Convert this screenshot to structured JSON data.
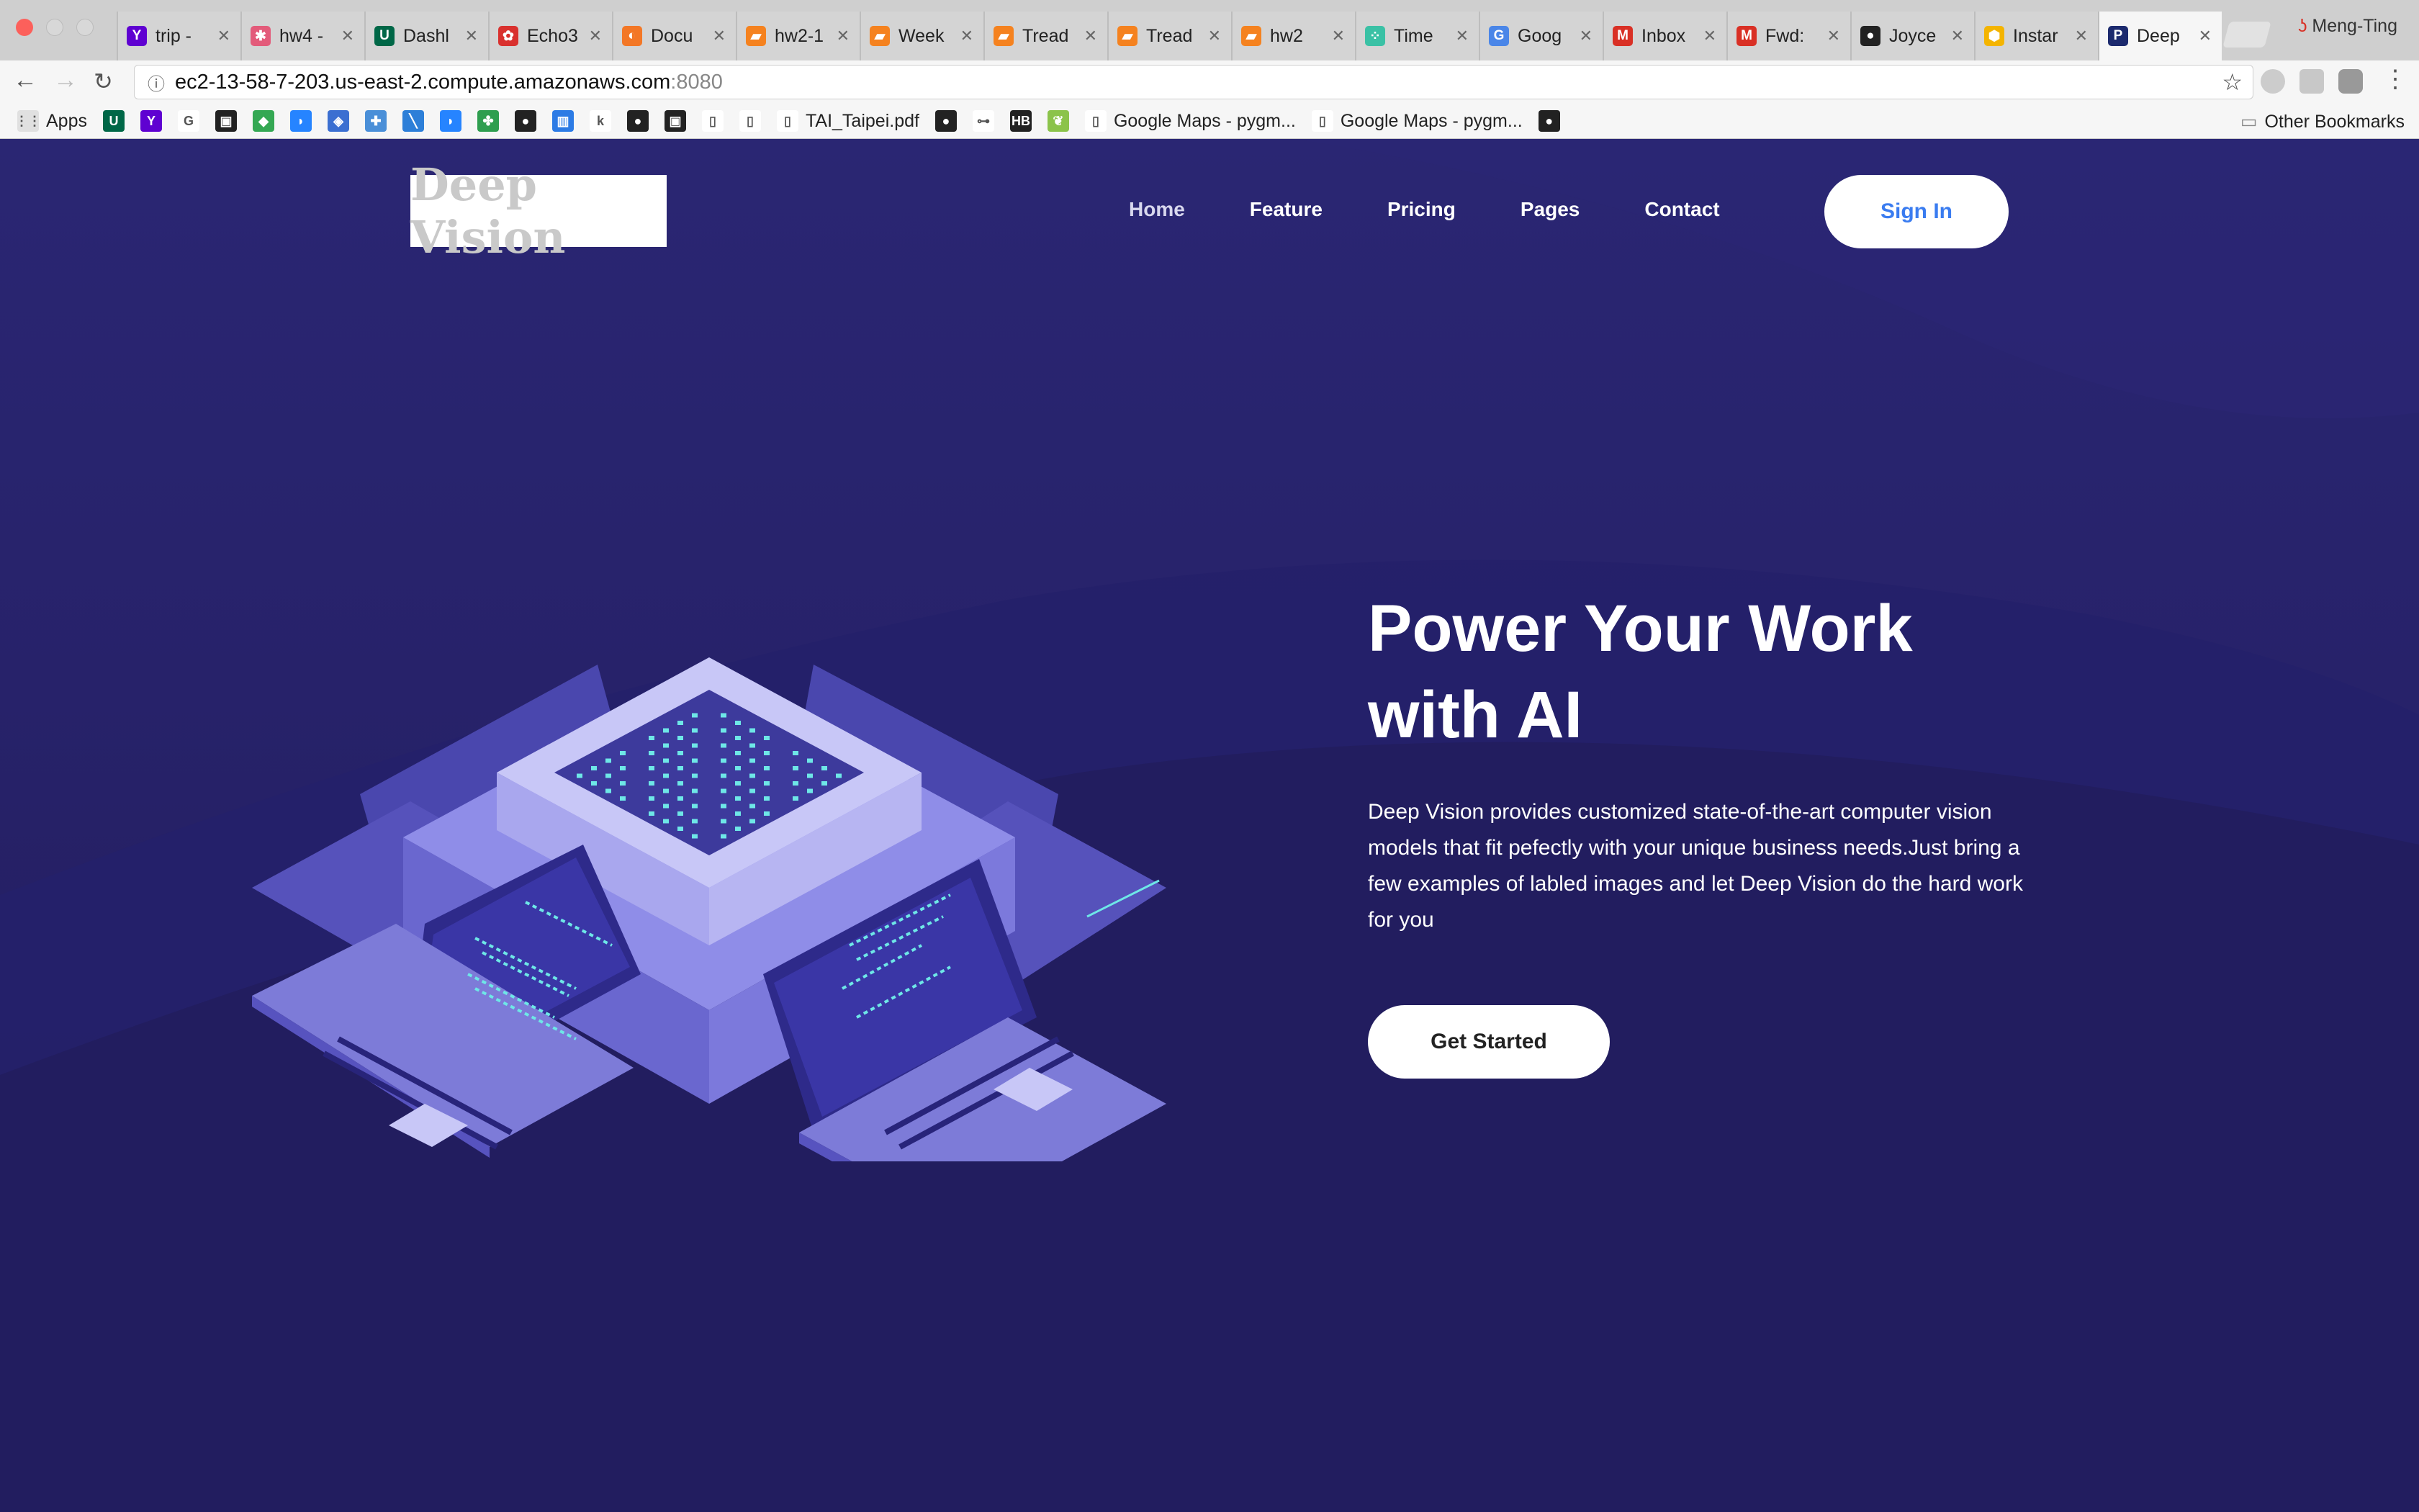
{
  "browser": {
    "tabs": [
      {
        "title": "trip -",
        "icon": "yahoo-icon",
        "color": "#5f01d1",
        "glyph": "Y",
        "active": false
      },
      {
        "title": "hw4 -",
        "icon": "asana-icon",
        "color": "#e35b7a",
        "glyph": "✱",
        "active": false
      },
      {
        "title": "Dashl",
        "icon": "usf-icon",
        "color": "#006747",
        "glyph": "U",
        "active": false
      },
      {
        "title": "Echo3",
        "icon": "echo-icon",
        "color": "#d9312e",
        "glyph": "✿",
        "active": false
      },
      {
        "title": "Docu",
        "icon": "jupyter-icon",
        "color": "#f37726",
        "glyph": "◐",
        "active": false
      },
      {
        "title": "hw2-1",
        "icon": "notebook-icon",
        "color": "#f5821f",
        "glyph": "▰",
        "active": false
      },
      {
        "title": "Week",
        "icon": "notebook-icon",
        "color": "#f5821f",
        "glyph": "▰",
        "active": false
      },
      {
        "title": "Tread",
        "icon": "notebook-icon",
        "color": "#f5821f",
        "glyph": "▰",
        "active": false
      },
      {
        "title": "Tread",
        "icon": "notebook-icon",
        "color": "#f5821f",
        "glyph": "▰",
        "active": false
      },
      {
        "title": "hw2",
        "icon": "notebook-icon",
        "color": "#f5821f",
        "glyph": "▰",
        "active": false
      },
      {
        "title": "Time",
        "icon": "timeline-icon",
        "color": "#3ac1a5",
        "glyph": "⁘",
        "active": false
      },
      {
        "title": "Goog",
        "icon": "google-translate-icon",
        "color": "#4a86e8",
        "glyph": "G",
        "active": false
      },
      {
        "title": "Inbox",
        "icon": "gmail-icon",
        "color": "#d93025",
        "glyph": "M",
        "active": false
      },
      {
        "title": "Fwd:",
        "icon": "gmail-icon",
        "color": "#d93025",
        "glyph": "M",
        "active": false
      },
      {
        "title": "Joyce",
        "icon": "github-icon",
        "color": "#222222",
        "glyph": "●",
        "active": false
      },
      {
        "title": "Instar",
        "icon": "instance-icon",
        "color": "#f4b400",
        "glyph": "⬢",
        "active": false
      },
      {
        "title": "Deep",
        "icon": "paypal-style-icon",
        "color": "#1c2a6e",
        "glyph": "P",
        "active": true
      }
    ],
    "profile_name": "Meng-Ting",
    "url_host": "ec2-13-58-7-203.us-east-2.compute.amazonaws.com",
    "url_port": ":8080",
    "bookmarks": [
      {
        "label": "Apps",
        "icon": "apps-grid-icon",
        "color": "#e0e0e0",
        "glyph": "⋮⋮"
      },
      {
        "label": "",
        "icon": "usf-icon",
        "color": "#006747",
        "glyph": "U"
      },
      {
        "label": "",
        "icon": "yahoo-icon",
        "color": "#5f01d1",
        "glyph": "Y"
      },
      {
        "label": "",
        "icon": "google-icon",
        "color": "#ffffff",
        "glyph": "G"
      },
      {
        "label": "",
        "icon": "bookmark-dark-icon",
        "color": "#222222",
        "glyph": "▣"
      },
      {
        "label": "",
        "icon": "maps-icon",
        "color": "#34a853",
        "glyph": "◆"
      },
      {
        "label": "",
        "icon": "bitbucket-icon",
        "color": "#2684ff",
        "glyph": "◗"
      },
      {
        "label": "",
        "icon": "stack-icon",
        "color": "#3b6fd1",
        "glyph": "◈"
      },
      {
        "label": "",
        "icon": "puzzle-icon",
        "color": "#4a8fd8",
        "glyph": "✚"
      },
      {
        "label": "",
        "icon": "slash-icon",
        "color": "#2d7fd8",
        "glyph": "╲"
      },
      {
        "label": "",
        "icon": "bitbucket-icon",
        "color": "#2684ff",
        "glyph": "◗"
      },
      {
        "label": "",
        "icon": "clover-icon",
        "color": "#2e9e4f",
        "glyph": "✤"
      },
      {
        "label": "",
        "icon": "github-icon",
        "color": "#222222",
        "glyph": "●"
      },
      {
        "label": "",
        "icon": "chart-icon",
        "color": "#2c7be5",
        "glyph": "▥"
      },
      {
        "label": "",
        "icon": "k-icon",
        "color": "#ffffff",
        "glyph": "k"
      },
      {
        "label": "",
        "icon": "github-icon",
        "color": "#222222",
        "glyph": "●"
      },
      {
        "label": "",
        "icon": "bookmark-dark-icon",
        "color": "#222222",
        "glyph": "▣"
      },
      {
        "label": "",
        "icon": "page-icon",
        "color": "#ffffff",
        "glyph": "▯"
      },
      {
        "label": "",
        "icon": "page-icon",
        "color": "#ffffff",
        "glyph": "▯"
      },
      {
        "label": "TAI_Taipei.pdf",
        "icon": "page-icon",
        "color": "#ffffff",
        "glyph": "▯"
      },
      {
        "label": "",
        "icon": "github-icon",
        "color": "#222222",
        "glyph": "●"
      },
      {
        "label": "",
        "icon": "connector-icon",
        "color": "#ffffff",
        "glyph": "⊶"
      },
      {
        "label": "",
        "icon": "hb-icon",
        "color": "#222222",
        "glyph": "HB"
      },
      {
        "label": "",
        "icon": "leaf-icon",
        "color": "#8bc34a",
        "glyph": "❦"
      },
      {
        "label": "Google Maps - pygm...",
        "icon": "page-icon",
        "color": "#ffffff",
        "glyph": "▯"
      },
      {
        "label": "Google Maps - pygm...",
        "icon": "page-icon",
        "color": "#ffffff",
        "glyph": "▯"
      },
      {
        "label": "",
        "icon": "github-icon",
        "color": "#222222",
        "glyph": "●"
      }
    ],
    "other_bookmarks": "Other Bookmarks"
  },
  "site": {
    "logo_text": "Deep Vision",
    "nav": [
      "Home",
      "Feature",
      "Pricing",
      "Pages",
      "Contact"
    ],
    "sign_in": "Sign In",
    "hero_title_1": "Power Your Work",
    "hero_title_2": "with AI",
    "hero_text": "Deep Vision provides customized state-of-the-art computer vision models that fit pefectly with your unique business needs.Just bring a few examples of labled images and let Deep Vision do the hard work for you",
    "cta": "Get Started",
    "colors": {
      "accent": "#3a7cf0",
      "bg": "#201c5a",
      "glow": "#6ee7e7"
    }
  }
}
